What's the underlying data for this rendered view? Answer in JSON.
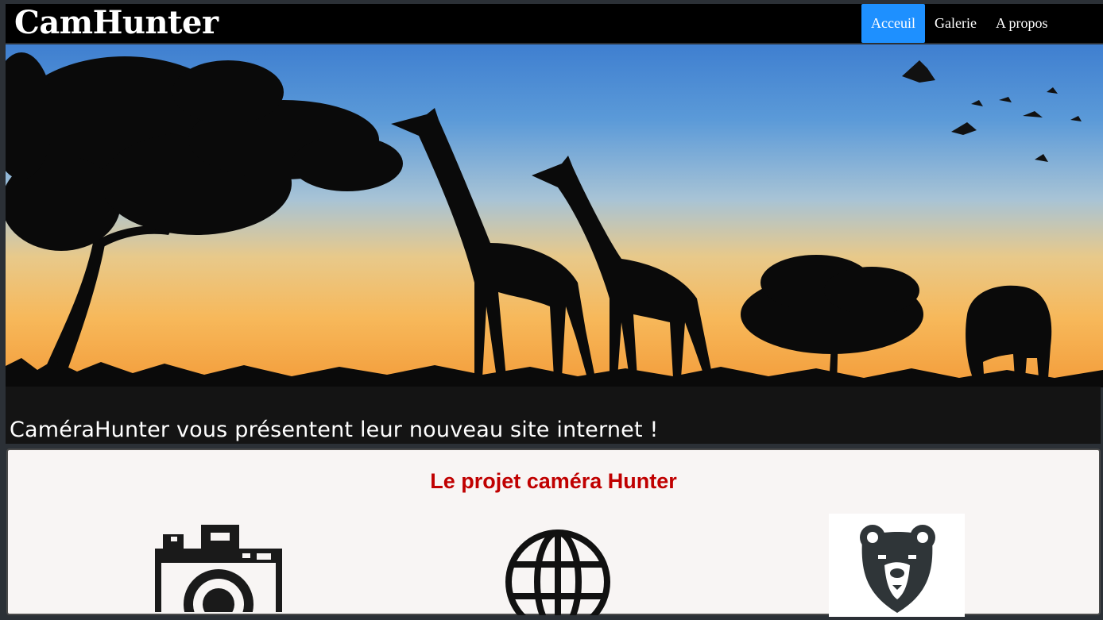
{
  "navbar": {
    "brand": "CamHunter",
    "items": [
      {
        "label": "Acceuil",
        "active": true
      },
      {
        "label": "Galerie",
        "active": false
      },
      {
        "label": "A propos",
        "active": false
      }
    ],
    "active_color": "#1e90ff"
  },
  "hero": {
    "image": "savanna-sunset-giraffes-silhouette",
    "caption": "CaméraHunter vous présentent leur nouveau site internet !"
  },
  "project": {
    "title": "Le projet caméra Hunter",
    "title_color": "#c00000",
    "icons": [
      "camera-icon",
      "globe-icon",
      "bear-logo-icon"
    ]
  }
}
